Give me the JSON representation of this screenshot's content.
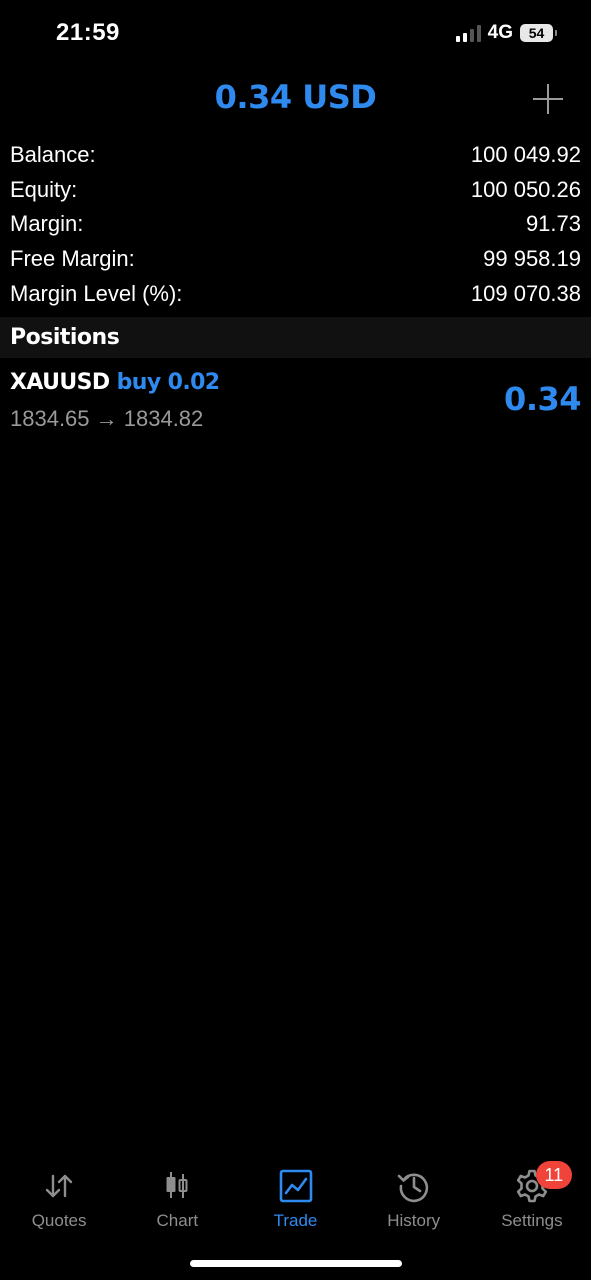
{
  "status_bar": {
    "time": "21:59",
    "network": "4G",
    "battery": "54"
  },
  "header": {
    "title": "0.34 USD",
    "add_icon": "plus-icon"
  },
  "summary": [
    {
      "label": "Balance:",
      "value": "100 049.92"
    },
    {
      "label": "Equity:",
      "value": "100 050.26"
    },
    {
      "label": "Margin:",
      "value": "91.73"
    },
    {
      "label": "Free Margin:",
      "value": "99 958.19"
    },
    {
      "label": "Margin Level (%):",
      "value": "109 070.38"
    }
  ],
  "positions": {
    "header": "Positions",
    "items": [
      {
        "symbol": "XAUUSD",
        "type": "buy 0.02",
        "prices": "1834.65 → 1834.82",
        "profit": "0.34"
      }
    ]
  },
  "tabbar": {
    "tabs": [
      {
        "label": "Quotes",
        "icon": "quotes-icon"
      },
      {
        "label": "Chart",
        "icon": "chart-icon"
      },
      {
        "label": "Trade",
        "icon": "trade-icon",
        "active": true
      },
      {
        "label": "History",
        "icon": "history-icon"
      },
      {
        "label": "Settings",
        "icon": "settings-icon",
        "badge": "11"
      }
    ]
  },
  "colors": {
    "accent": "#2f8af0",
    "badge": "#f0433a",
    "muted": "#8e8e8e"
  }
}
